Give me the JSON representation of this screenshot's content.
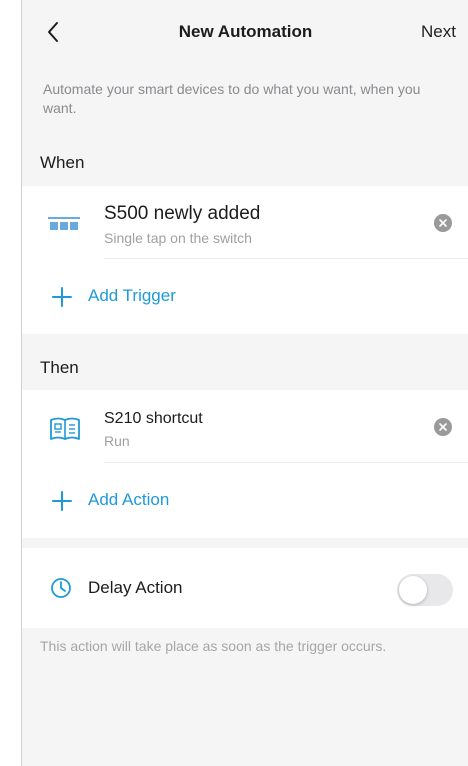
{
  "header": {
    "title": "New Automation",
    "next_label": "Next"
  },
  "intro": "Automate your smart devices to do what you want, when you want.",
  "when": {
    "label": "When",
    "trigger": {
      "title": "S500 newly added",
      "subtitle": "Single tap on the switch",
      "icon": "switch-icon"
    },
    "add_label": "Add Trigger"
  },
  "then": {
    "label": "Then",
    "action": {
      "title": "S210 shortcut",
      "subtitle": "Run",
      "icon": "shortcut-panel-icon"
    },
    "add_label": "Add Action"
  },
  "delay": {
    "label": "Delay Action",
    "enabled": false,
    "icon": "clock-icon"
  },
  "footnote": "This action will take place as soon as the trigger occurs.",
  "colors": {
    "accent": "#1f9ad6",
    "background": "#f5f5f5",
    "card": "#ffffff"
  }
}
